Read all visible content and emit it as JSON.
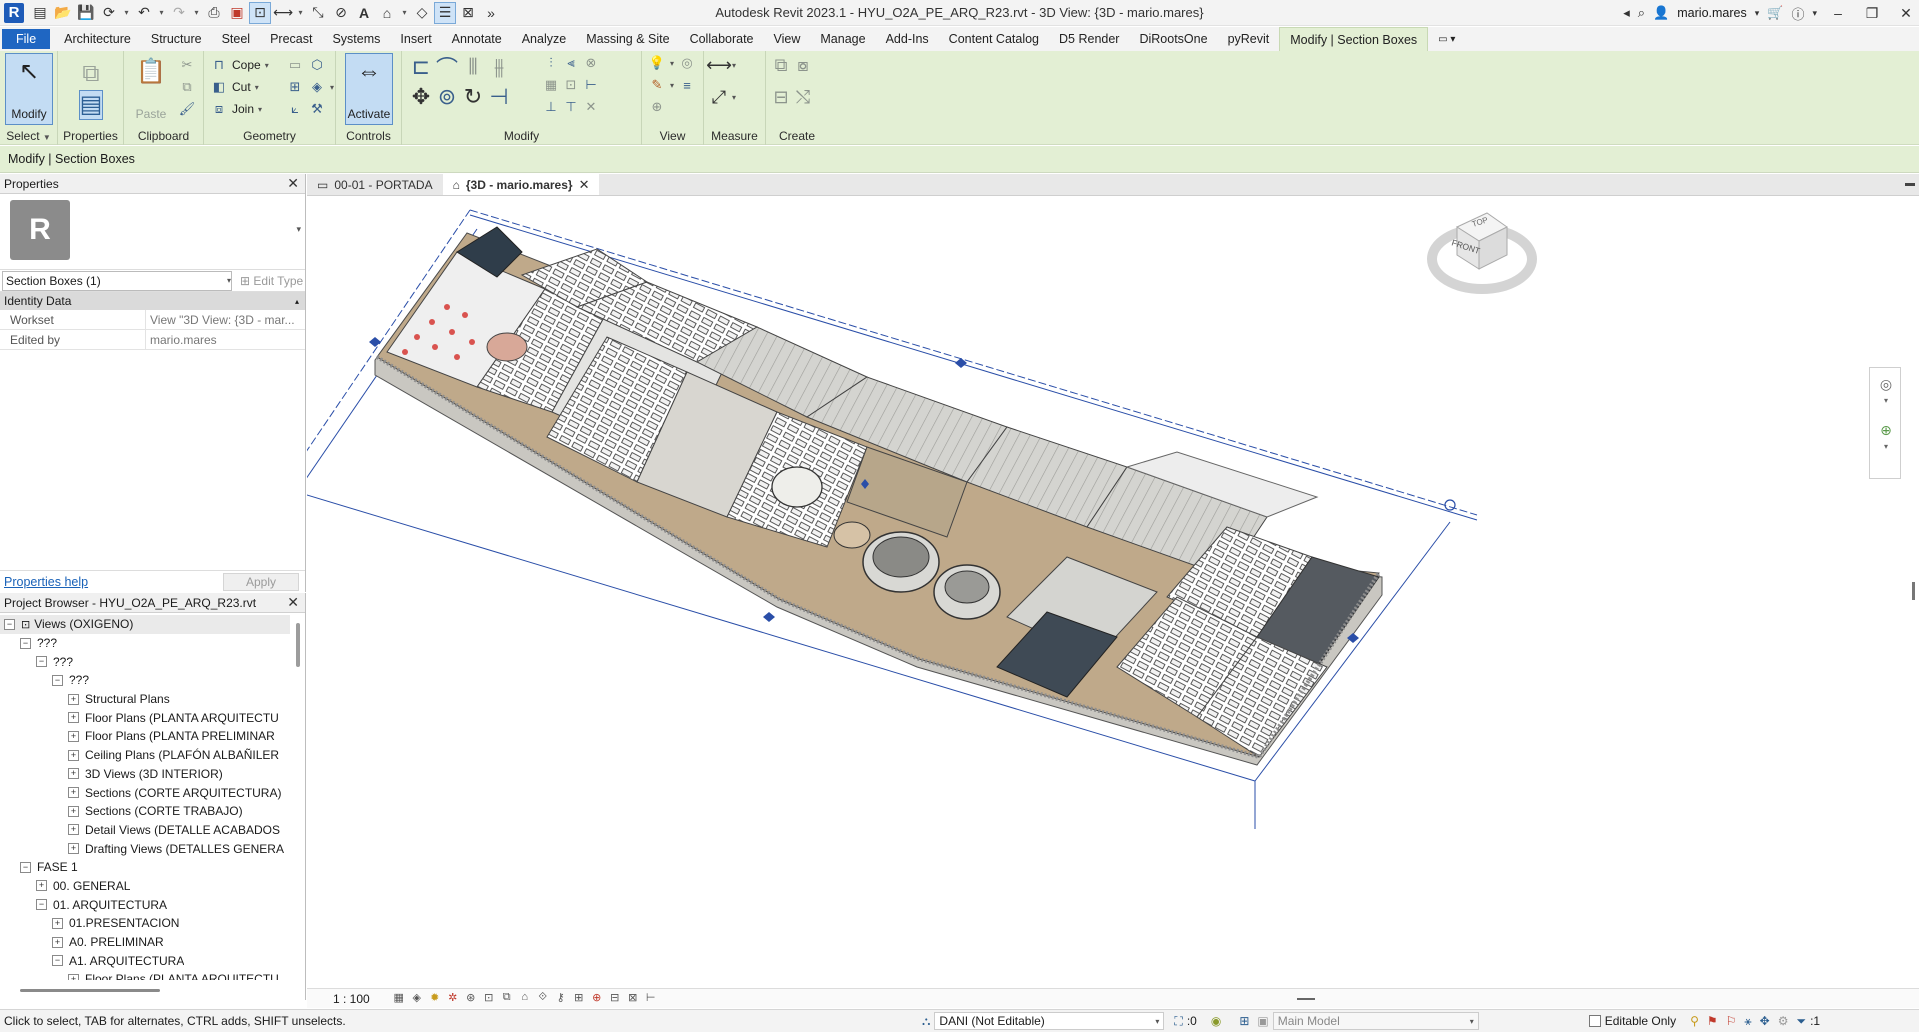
{
  "app": {
    "title": "Autodesk Revit 2023.1 - HYU_O2A_PE_ARQ_R23.rvt - 3D View: {3D - mario.mares}",
    "logo_letter": "R",
    "user": "mario.mares"
  },
  "quick_access": [
    "open-icon",
    "save-icon",
    "sync-icon",
    "undo-icon",
    "redo-icon",
    "print-icon",
    "pdf-icon",
    "tag-icon",
    "measure-icon",
    "text-icon",
    "3d-view-icon",
    "section-icon",
    "thin-lines-icon",
    "close-hidden-icon",
    "more-icon"
  ],
  "ribbon_tabs": [
    {
      "label": "File",
      "kind": "file"
    },
    {
      "label": "Architecture"
    },
    {
      "label": "Structure"
    },
    {
      "label": "Steel"
    },
    {
      "label": "Precast"
    },
    {
      "label": "Systems"
    },
    {
      "label": "Insert"
    },
    {
      "label": "Annotate"
    },
    {
      "label": "Analyze"
    },
    {
      "label": "Massing & Site"
    },
    {
      "label": "Collaborate"
    },
    {
      "label": "View"
    },
    {
      "label": "Manage"
    },
    {
      "label": "Add-Ins"
    },
    {
      "label": "Content Catalog"
    },
    {
      "label": "D5 Render"
    },
    {
      "label": "DiRootsOne"
    },
    {
      "label": "pyRevit"
    },
    {
      "label": "Modify | Section Boxes",
      "kind": "active"
    }
  ],
  "ribbon": {
    "select": {
      "modify": "Modify",
      "label": "Select"
    },
    "properties": {
      "label": "Properties"
    },
    "clipboard": {
      "paste": "Paste",
      "label": "Clipboard"
    },
    "geometry": {
      "cope": "Cope",
      "cut": "Cut",
      "join": "Join",
      "label": "Geometry"
    },
    "controls": {
      "activate": "Activate",
      "label": "Controls"
    },
    "modify": {
      "label": "Modify"
    },
    "view": {
      "label": "View"
    },
    "measure": {
      "label": "Measure"
    },
    "create": {
      "label": "Create"
    }
  },
  "options_bar": {
    "text": "Modify | Section Boxes"
  },
  "properties": {
    "title": "Properties",
    "type_letter": "R",
    "type_selector": "Section Boxes (1)",
    "edit_type": "Edit Type",
    "group": "Identity Data",
    "rows": [
      {
        "key": "Workset",
        "value": "View \"3D View: {3D - mar..."
      },
      {
        "key": "Edited by",
        "value": "mario.mares"
      }
    ],
    "help_link": "Properties help",
    "apply": "Apply"
  },
  "browser": {
    "title": "Project Browser - HYU_O2A_PE_ARQ_R23.rvt",
    "nodes": [
      {
        "label": "Views (OXIGENO)",
        "level": 0,
        "toggle": "−",
        "root": true
      },
      {
        "label": "???",
        "level": 1,
        "toggle": "−"
      },
      {
        "label": "???",
        "level": 2,
        "toggle": "−"
      },
      {
        "label": "???",
        "level": 3,
        "toggle": "−"
      },
      {
        "label": "Structural Plans",
        "level": 4,
        "toggle": "+"
      },
      {
        "label": "Floor Plans (PLANTA ARQUITECTU",
        "level": 4,
        "toggle": "+"
      },
      {
        "label": "Floor Plans (PLANTA PRELIMINAR",
        "level": 4,
        "toggle": "+"
      },
      {
        "label": "Ceiling Plans (PLAFÓN ALBAÑILER",
        "level": 4,
        "toggle": "+"
      },
      {
        "label": "3D Views (3D INTERIOR)",
        "level": 4,
        "toggle": "+"
      },
      {
        "label": "Sections (CORTE ARQUITECTURA)",
        "level": 4,
        "toggle": "+"
      },
      {
        "label": "Sections (CORTE TRABAJO)",
        "level": 4,
        "toggle": "+"
      },
      {
        "label": "Detail Views (DETALLE ACABADOS",
        "level": 4,
        "toggle": "+"
      },
      {
        "label": "Drafting Views (DETALLES GENERA",
        "level": 4,
        "toggle": "+"
      },
      {
        "label": "FASE 1",
        "level": 1,
        "toggle": "−"
      },
      {
        "label": "00. GENERAL",
        "level": 2,
        "toggle": "+"
      },
      {
        "label": "01. ARQUITECTURA",
        "level": 2,
        "toggle": "−"
      },
      {
        "label": "01.PRESENTACION",
        "level": 3,
        "toggle": "+"
      },
      {
        "label": "A0. PRELIMINAR",
        "level": 3,
        "toggle": "+"
      },
      {
        "label": "A1. ARQUITECTURA",
        "level": 3,
        "toggle": "−"
      },
      {
        "label": "Floor Plans (PLANTA ARQUITECTU",
        "level": 4,
        "toggle": "+"
      }
    ]
  },
  "view_tabs": [
    {
      "label": "00-01 - PORTADA",
      "active": false
    },
    {
      "label": "{3D - mario.mares}",
      "active": true
    }
  ],
  "viewcube": {
    "top": "TOP",
    "front": "FRONT"
  },
  "view_control": {
    "scale": "1 : 100"
  },
  "status": {
    "text": "Click to select, TAB for alternates, CTRL adds, SHIFT unselects.",
    "workset": "DANI (Not Editable)",
    "selection_count": ":0",
    "design_option": "Main Model",
    "editable_only": "Editable Only",
    "filter_count": ":1"
  }
}
